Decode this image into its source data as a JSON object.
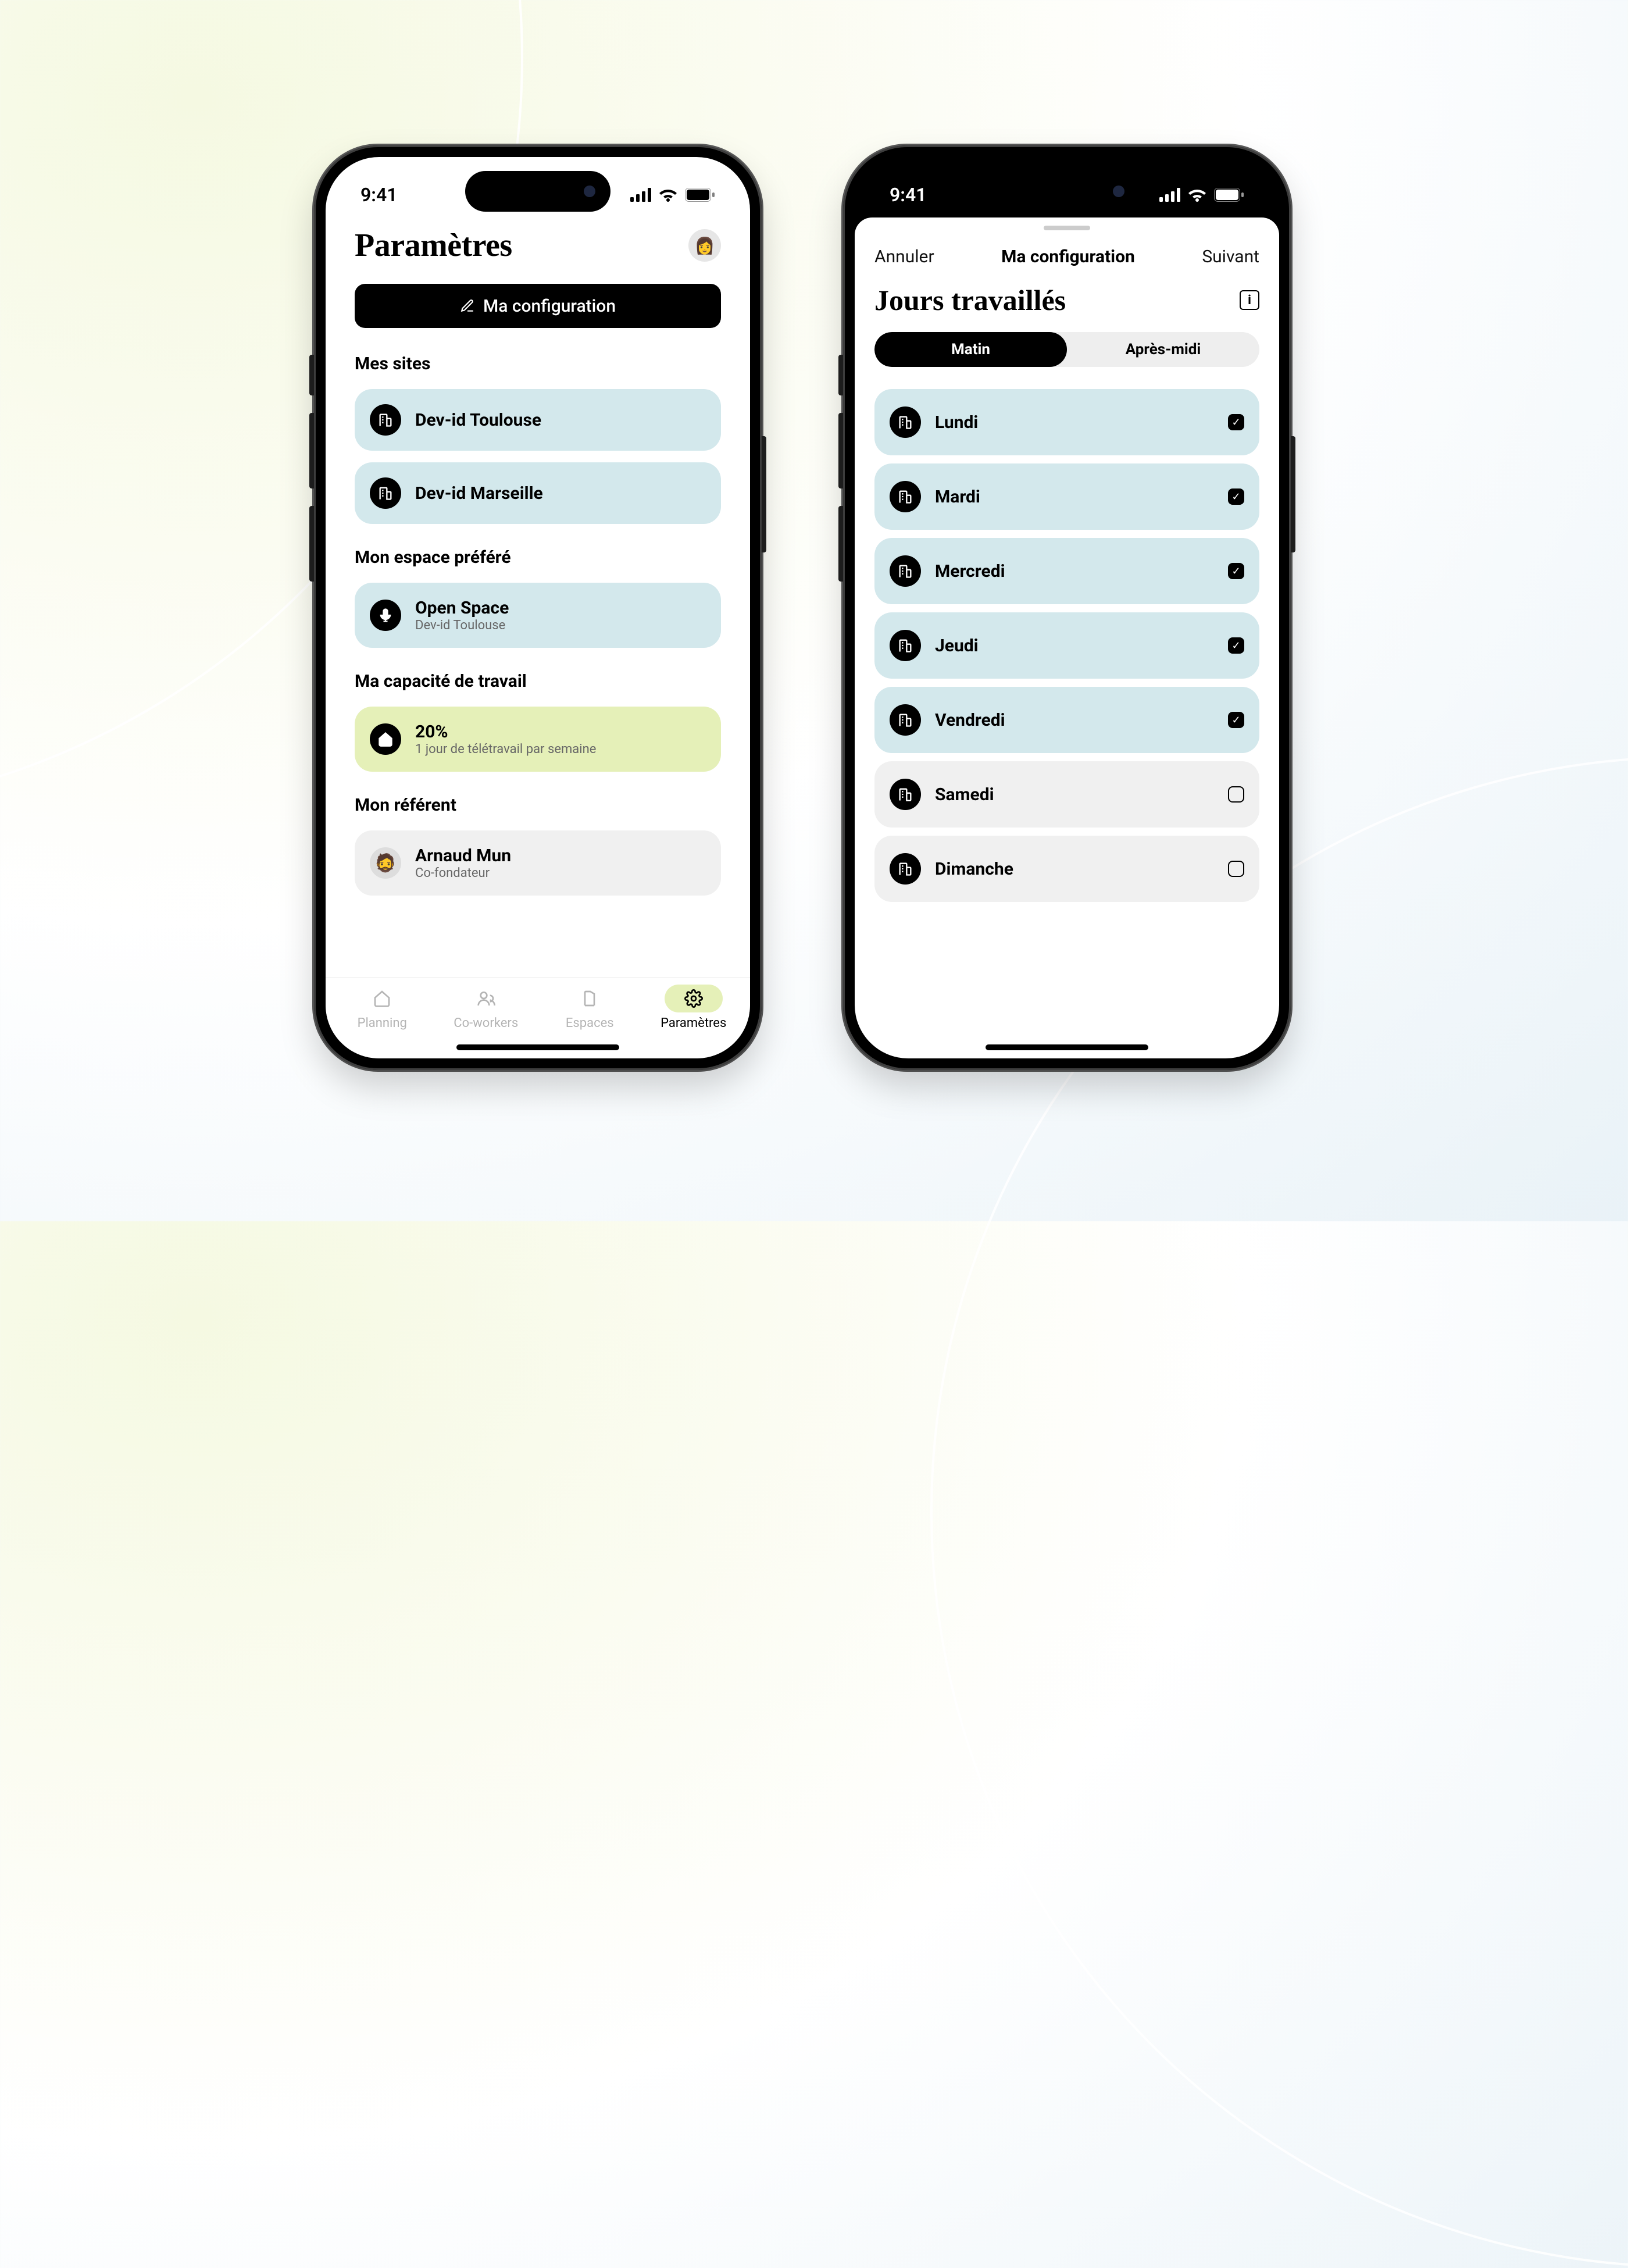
{
  "status": {
    "time": "9:41"
  },
  "screen1": {
    "title": "Paramètres",
    "config_btn": "Ma configuration",
    "sites_heading": "Mes sites",
    "sites": [
      {
        "name": "Dev-id Toulouse"
      },
      {
        "name": "Dev-id Marseille"
      }
    ],
    "space_heading": "Mon espace préféré",
    "space": {
      "name": "Open Space",
      "sub": "Dev-id Toulouse"
    },
    "capacity_heading": "Ma capacité de travail",
    "capacity": {
      "value": "20%",
      "sub": "1 jour de télétravail par semaine"
    },
    "referent_heading": "Mon référent",
    "referent": {
      "name": "Arnaud Mun",
      "sub": "Co-fondateur"
    },
    "tabs": {
      "planning": "Planning",
      "coworkers": "Co-workers",
      "espaces": "Espaces",
      "params": "Paramètres"
    }
  },
  "screen2": {
    "cancel": "Annuler",
    "title": "Ma configuration",
    "next": "Suivant",
    "jours": "Jours travaillés",
    "seg_morning": "Matin",
    "seg_afternoon": "Après-midi",
    "days": [
      {
        "label": "Lundi",
        "on": true
      },
      {
        "label": "Mardi",
        "on": true
      },
      {
        "label": "Mercredi",
        "on": true
      },
      {
        "label": "Jeudi",
        "on": true
      },
      {
        "label": "Vendredi",
        "on": true
      },
      {
        "label": "Samedi",
        "on": false
      },
      {
        "label": "Dimanche",
        "on": false
      }
    ]
  }
}
